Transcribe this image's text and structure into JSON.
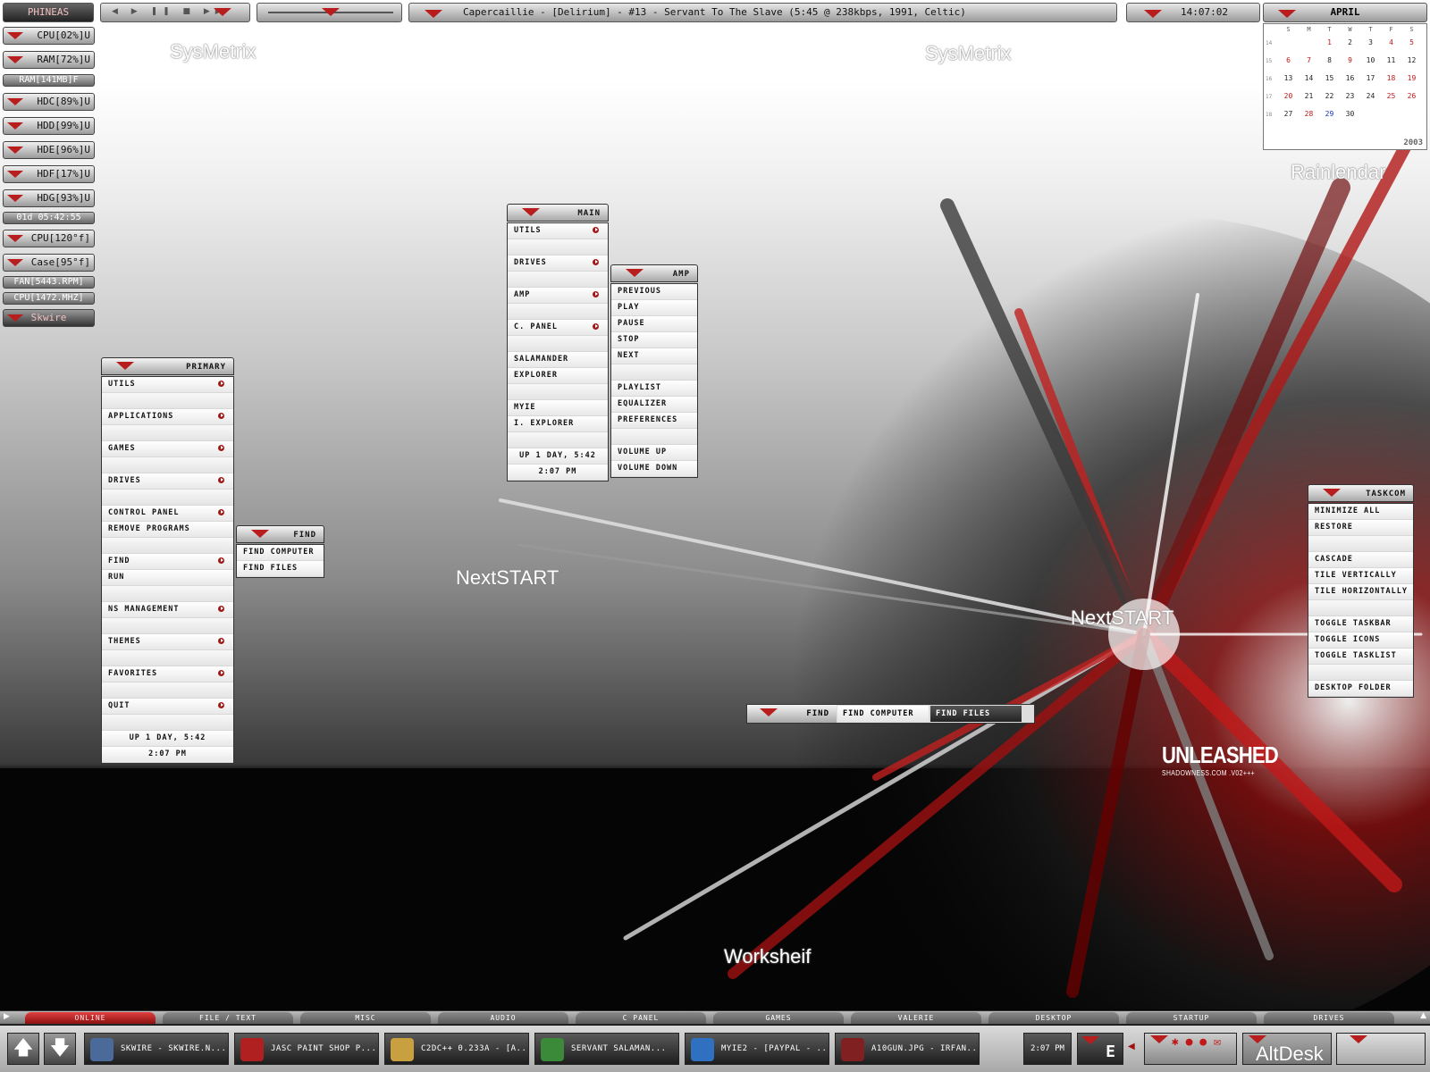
{
  "topbar": {
    "user": "PHINEAS",
    "now_playing": "Capercaillie - [Delirium] - #13 - Servant To The Slave (5:45 @ 238kbps, 1991, Celtic)",
    "clock": "14:07:02",
    "calendar_month": "APRIL"
  },
  "sysmetrix": {
    "items": [
      "CPU[02%]U",
      "RAM[72%]U",
      "RAM[141MB]F",
      "HDC[89%]U",
      "HDD[99%]U",
      "HDE[96%]U",
      "HDF[17%]U",
      "HDG[93%]U",
      "01d 05:42:55",
      "CPU[120°f]",
      "Case[95°f]",
      "FAN[5443.RPM]",
      "CPU[1472.MHZ]",
      "Skwire"
    ]
  },
  "calendar": {
    "weekday_headers": [
      "S",
      "M",
      "T",
      "W",
      "T",
      "F",
      "S"
    ],
    "week_numbers": [
      "14",
      "15",
      "16",
      "17",
      "18"
    ],
    "rows": [
      [
        "",
        "",
        "1",
        "2",
        "3",
        "4",
        "5"
      ],
      [
        "6",
        "7",
        "8",
        "9",
        "10",
        "11",
        "12"
      ],
      [
        "13",
        "14",
        "15",
        "16",
        "17",
        "18",
        "19"
      ],
      [
        "20",
        "21",
        "22",
        "23",
        "24",
        "25",
        "26"
      ],
      [
        "27",
        "28",
        "29",
        "30",
        "",
        "",
        ""
      ]
    ],
    "year": "2003",
    "highlight_red": [
      "1",
      "4",
      "5",
      "6",
      "7",
      "9",
      "18",
      "19",
      "20",
      "25",
      "26",
      "28"
    ],
    "highlight_blue": [
      "29"
    ],
    "label": "Rainlendar"
  },
  "watermarks": {
    "sysmetrix": "SysMetrix",
    "nextstart": "NextSTART",
    "worksheIf": "Worksheif",
    "altdesk": "AltDesk",
    "unleashed": "UNLEASHED",
    "unleashed_sub": "SHADOWNESS.COM .V02+++"
  },
  "primary_menu": {
    "title": "PRIMARY",
    "items": [
      {
        "label": "Utils",
        "sub": true
      },
      {
        "label": "",
        "sub": false
      },
      {
        "label": "Applications",
        "sub": true
      },
      {
        "label": "",
        "sub": false
      },
      {
        "label": "Games",
        "sub": true
      },
      {
        "label": "",
        "sub": false
      },
      {
        "label": "Drives",
        "sub": true
      },
      {
        "label": "",
        "sub": false
      },
      {
        "label": "Control Panel",
        "sub": true
      },
      {
        "label": "Remove Programs",
        "sub": false
      },
      {
        "label": "",
        "sub": false
      },
      {
        "label": "Find",
        "sub": true
      },
      {
        "label": "Run",
        "sub": false
      },
      {
        "label": "",
        "sub": false
      },
      {
        "label": "NS Management",
        "sub": true
      },
      {
        "label": "",
        "sub": false
      },
      {
        "label": "Themes",
        "sub": true
      },
      {
        "label": "",
        "sub": false
      },
      {
        "label": "Favorites",
        "sub": true
      },
      {
        "label": "",
        "sub": false
      },
      {
        "label": "Quit",
        "sub": true
      },
      {
        "label": "",
        "sub": false
      }
    ],
    "uptime": "UP 1 DAY, 5:42",
    "time": "2:07 PM"
  },
  "find_menu": {
    "title": "FIND",
    "items": [
      "Find Computer",
      "Find Files"
    ]
  },
  "main_menu": {
    "title": "MAIN",
    "items": [
      {
        "label": "Utils",
        "sub": true
      },
      {
        "label": "",
        "sub": false
      },
      {
        "label": "Drives",
        "sub": true
      },
      {
        "label": "",
        "sub": false
      },
      {
        "label": "Amp",
        "sub": true
      },
      {
        "label": "",
        "sub": false
      },
      {
        "label": "C. Panel",
        "sub": true
      },
      {
        "label": "",
        "sub": false
      },
      {
        "label": "Salamander",
        "sub": false
      },
      {
        "label": "Explorer",
        "sub": false
      },
      {
        "label": "",
        "sub": false
      },
      {
        "label": "MyIE",
        "sub": false
      },
      {
        "label": "I. Explorer",
        "sub": false
      },
      {
        "label": "",
        "sub": false
      }
    ],
    "uptime": "UP 1 DAY, 5:42",
    "time": "2:07 PM"
  },
  "amp_menu": {
    "title": "AMP",
    "items": [
      "Previous",
      "Play",
      "Pause",
      "Stop",
      "Next",
      "",
      "Playlist",
      "Equalizer",
      "Preferences",
      "",
      "Volume Up",
      "Volume Down"
    ]
  },
  "taskcom_menu": {
    "title": "TASKCOM",
    "items": [
      "Minimize All",
      "Restore",
      "",
      "Cascade",
      "Tile Vertically",
      "Tile Horizontally",
      "",
      "Toggle Taskbar",
      "Toggle Icons",
      "Toggle Tasklist",
      "",
      "Desktop Folder"
    ]
  },
  "findbar": {
    "title": "FIND",
    "computer": "FIND COMPUTER",
    "files": "FIND FILES"
  },
  "tabs": [
    "ONLINE",
    "FILE / TEXT",
    "MISC",
    "AUDIO",
    "C PANEL",
    "GAMES",
    "VALERIE",
    "DESKTOP",
    "STARTUP",
    "DRIVES"
  ],
  "active_tab": "ONLINE",
  "tasks": [
    {
      "label": "Skwire - Skwire.n...",
      "icon": "monitor-icon",
      "color": "#4a6a9a"
    },
    {
      "label": "Jasc Paint Shop P...",
      "icon": "psp-icon",
      "color": "#b02020"
    },
    {
      "label": "C2DC++ 0.233a - [A...",
      "icon": "popeye-icon",
      "color": "#c8a040"
    },
    {
      "label": "Servant Salaman...",
      "icon": "salamander-icon",
      "color": "#3a8a3a"
    },
    {
      "label": "MyIE2 - [PayPal - ...",
      "icon": "myie-icon",
      "color": "#3070c0"
    },
    {
      "label": "A10gun.jpg - Irfan...",
      "icon": "irfanview-icon",
      "color": "#802020"
    }
  ],
  "tray": {
    "time": "2:07 PM",
    "letter": "E"
  },
  "colors": {
    "accent": "#b81e1e",
    "bar": "#9a9a9a"
  }
}
